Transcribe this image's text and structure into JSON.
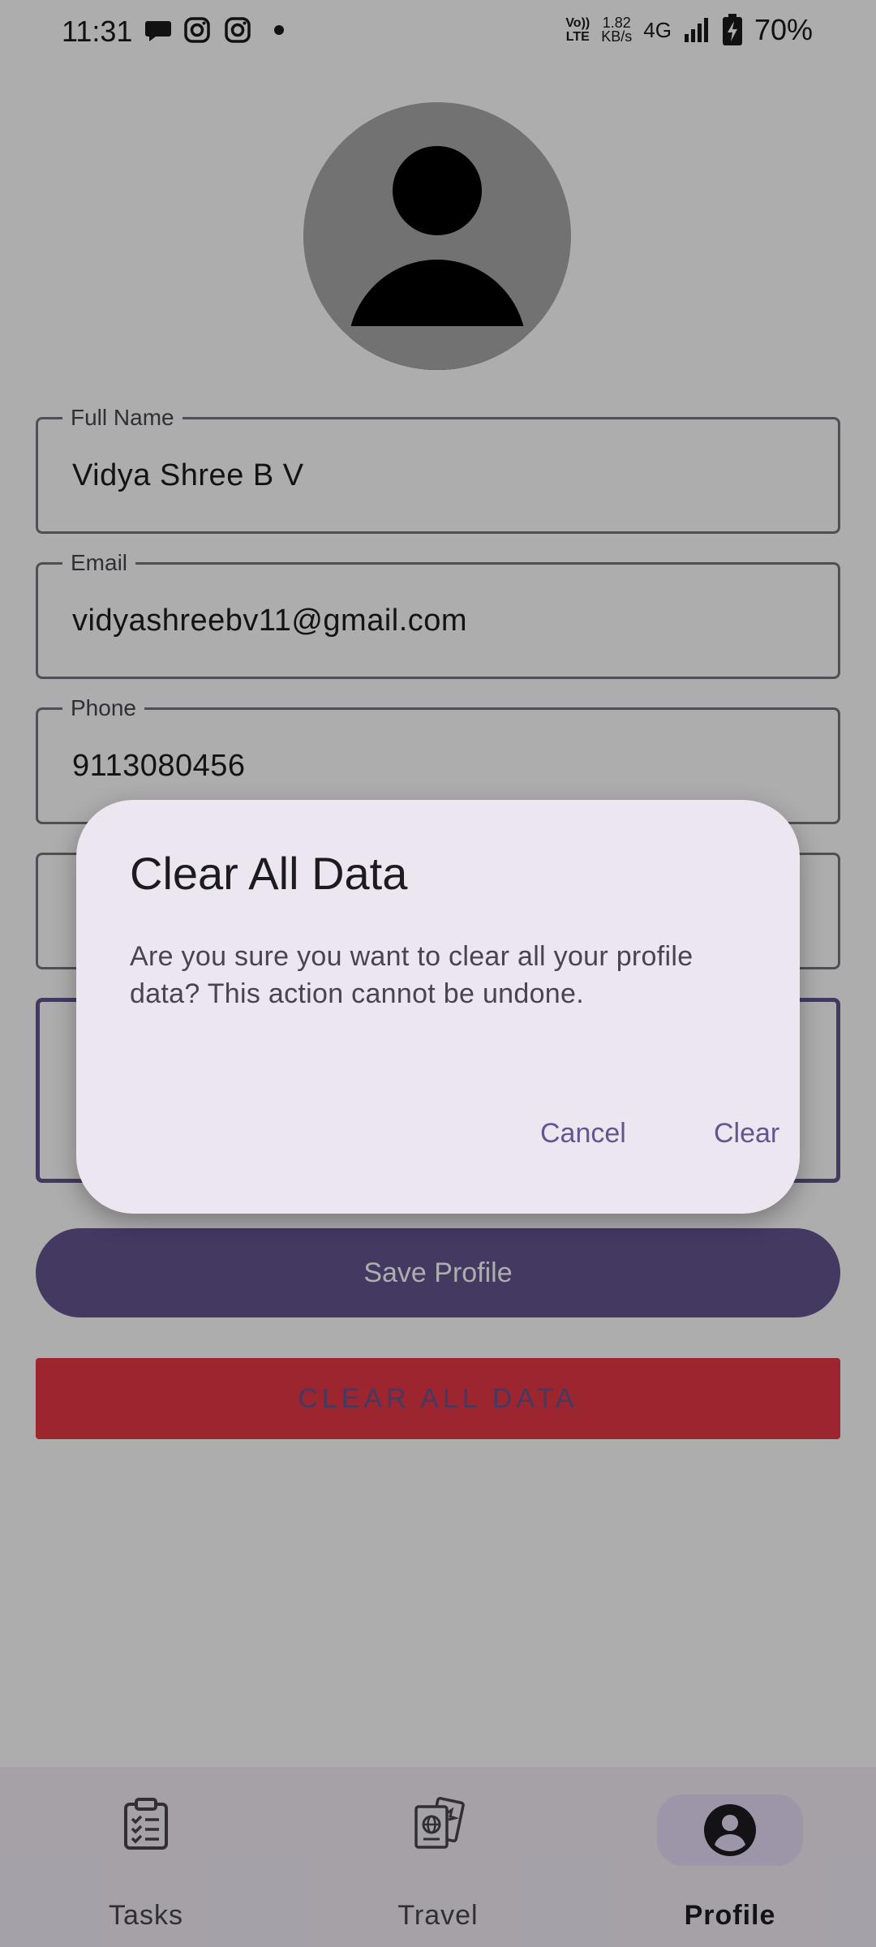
{
  "status_bar": {
    "time": "11:31",
    "notifications": [
      "chat-bubble-icon",
      "instagram-icon",
      "instagram-icon",
      "dot-icon"
    ],
    "volte_top": "Vo))",
    "volte_bottom": "LTE",
    "speed_top": "1.82",
    "speed_bottom": "KB/s",
    "network": "4G",
    "battery": "70%"
  },
  "profile": {
    "fields": [
      {
        "label": "Full Name",
        "value": "Vidya Shree B V"
      },
      {
        "label": "Email",
        "value": "vidyashreebv11@gmail.com"
      },
      {
        "label": "Phone",
        "value": "9113080456"
      },
      {
        "label": "",
        "value": ""
      },
      {
        "label": "",
        "value": ""
      }
    ],
    "save_label": "Save Profile",
    "clear_all_label": "CLEAR ALL DATA"
  },
  "dialog": {
    "title": "Clear All Data",
    "message": "Are you sure you want to clear all your profile data? This action cannot be undone.",
    "cancel_label": "Cancel",
    "confirm_label": "Clear"
  },
  "bottom_nav": {
    "items": [
      {
        "label": "Tasks",
        "icon": "clipboard-checklist-icon"
      },
      {
        "label": "Travel",
        "icon": "passport-icon"
      },
      {
        "label": "Profile",
        "icon": "account-circle-icon"
      }
    ],
    "active": "Profile"
  },
  "colors": {
    "primary": "#65558f",
    "danger": "#e53946",
    "dialog_bg": "#ece6f0",
    "nav_bg": "#f3edf7"
  }
}
